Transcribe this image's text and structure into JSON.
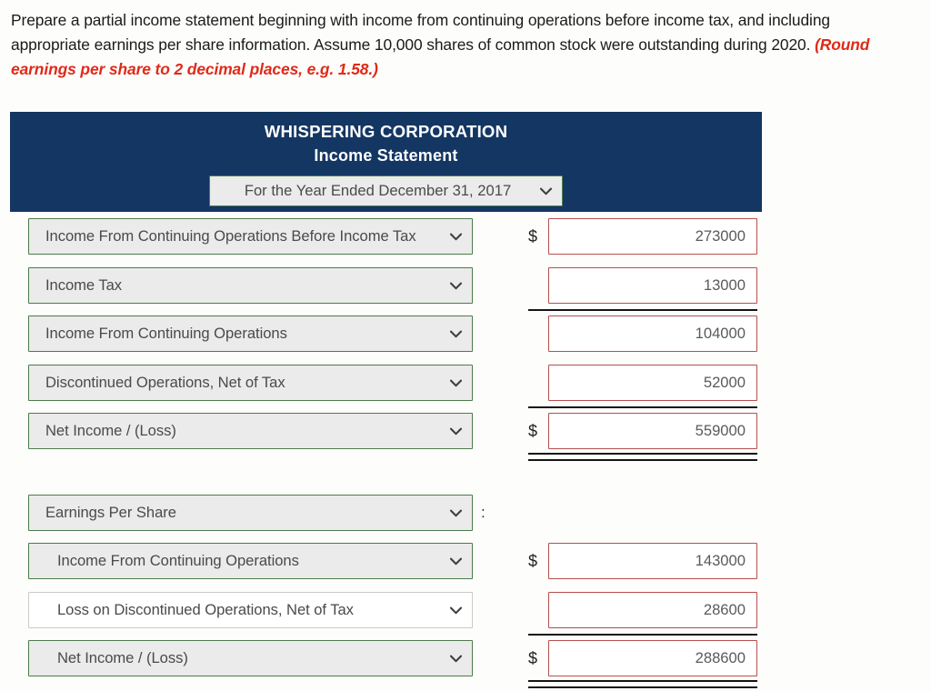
{
  "instructions": {
    "text": "Prepare a partial income statement beginning with income from continuing operations before income tax, and including appropriate earnings per share information. Assume 10,000 shares of common stock were outstanding during 2020. ",
    "hint": "(Round earnings per share to 2 decimal places, e.g. 1.58.)"
  },
  "statement": {
    "company": "WHISPERING CORPORATION",
    "title": "Income Statement",
    "period_select": {
      "value": "For the Year Ended December 31, 2017",
      "icon": "chevron-down-icon"
    },
    "currency_symbol": "$",
    "colon": ":",
    "rows": [
      {
        "label": "Income From Continuing Operations Before Income Tax",
        "amount": "273000",
        "dollar": true,
        "indent": false,
        "style": "selected",
        "rule": "none"
      },
      {
        "label": "Income Tax",
        "amount": "13000",
        "dollar": false,
        "indent": false,
        "style": "selected",
        "rule": "single"
      },
      {
        "label": "Income From Continuing Operations",
        "amount": "104000",
        "dollar": false,
        "indent": false,
        "style": "selected",
        "rule": "none"
      },
      {
        "label": "Discontinued Operations, Net of Tax",
        "amount": "52000",
        "dollar": false,
        "indent": false,
        "style": "selected",
        "rule": "single"
      },
      {
        "label": "Net Income / (Loss)",
        "amount": "559000",
        "dollar": true,
        "indent": false,
        "style": "selected",
        "rule": "double"
      },
      {
        "label": "Earnings Per Share",
        "amount": "",
        "dollar": false,
        "indent": false,
        "style": "selected",
        "rule": "none",
        "colon": true,
        "no_amount": true
      },
      {
        "label": "Income From Continuing Operations",
        "amount": "143000",
        "dollar": true,
        "indent": true,
        "style": "selected",
        "rule": "none"
      },
      {
        "label": "Loss on Discontinued Operations, Net of Tax",
        "amount": "28600",
        "dollar": false,
        "indent": true,
        "style": "plain",
        "rule": "single"
      },
      {
        "label": "Net Income / (Loss)",
        "amount": "288600",
        "dollar": true,
        "indent": true,
        "style": "selected",
        "rule": "double"
      }
    ]
  },
  "colors": {
    "header_bg": "#143663",
    "select_border": "#4c7b4c",
    "select_bg": "#ebebeb",
    "input_border": "#b5504f",
    "hint_text": "#e02a18"
  }
}
